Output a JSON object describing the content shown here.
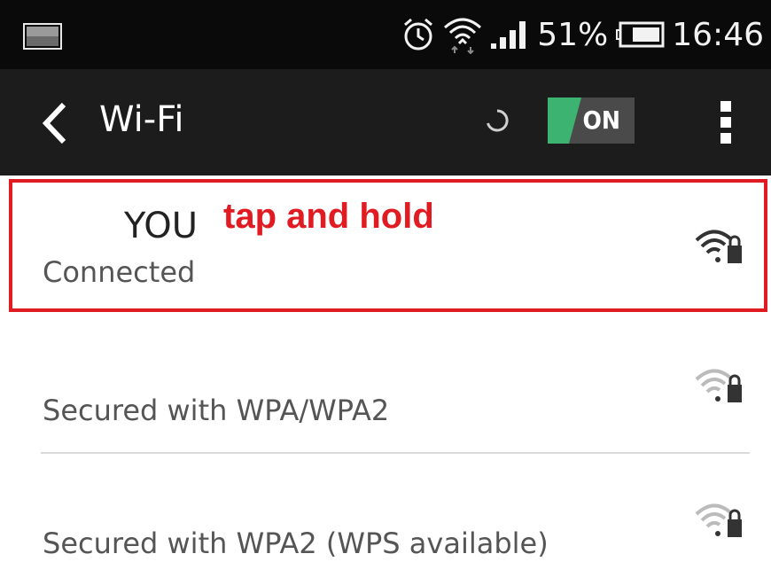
{
  "status_bar": {
    "battery_percent": "51%",
    "time": "16:46",
    "icons": [
      "notification-image-icon",
      "alarm-icon",
      "wifi-signal-icon",
      "cell-signal-icon",
      "battery-icon"
    ]
  },
  "action_bar": {
    "title": "Wi-Fi",
    "toggle_label": "ON",
    "icons": [
      "back-arrow-icon",
      "loading-spinner-icon",
      "overflow-menu-icon"
    ]
  },
  "annotation": "tap and hold",
  "networks": [
    {
      "name": "YOU",
      "status": "Connected",
      "signal": "strong",
      "secured": true
    },
    {
      "name": "",
      "status": "Secured with WPA/WPA2",
      "signal": "weak",
      "secured": true
    },
    {
      "name": "",
      "status": "Secured with WPA2 (WPS available)",
      "signal": "weak",
      "secured": true
    }
  ],
  "colors": {
    "status_bar_bg": "#0a0a0a",
    "action_bar_bg": "#1c1c1c",
    "toggle_on": "#3cb371",
    "annotation_red": "#e11b22"
  }
}
